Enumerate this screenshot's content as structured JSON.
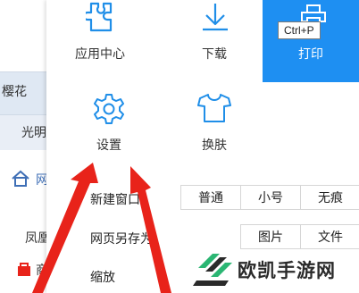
{
  "background": {
    "texts": [
      "樱花",
      "光明",
      "网",
      "凤凰",
      "商"
    ]
  },
  "menu": {
    "tiles": [
      {
        "label": "应用中心",
        "icon": "puzzle-icon"
      },
      {
        "label": "下载",
        "icon": "download-icon"
      },
      {
        "label": "打印",
        "icon": "printer-icon"
      },
      {
        "label": "设置",
        "icon": "gear-icon"
      },
      {
        "label": "换肤",
        "icon": "shirt-icon"
      }
    ],
    "tooltip": "Ctrl+P",
    "items": {
      "new_window": "新建窗口",
      "save_page": "网页另存为",
      "zoom": "缩放"
    },
    "mode_options": [
      "普通",
      "小号",
      "无痕"
    ],
    "save_options": [
      "图片",
      "文件"
    ]
  },
  "watermark": {
    "text": "欧凯手游网"
  },
  "colors": {
    "accent": "#1e8ff2",
    "arrow": "#e8231a",
    "icon": "#1f8ee8"
  }
}
